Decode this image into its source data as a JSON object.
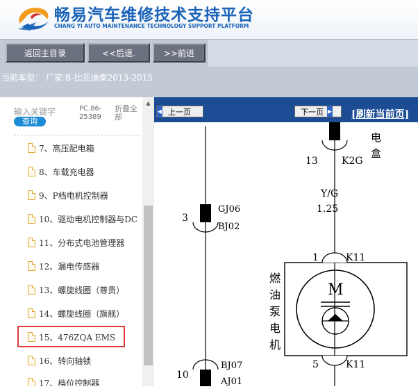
{
  "header": {
    "title": "畅易汽车维修技术支持平台",
    "subtitle": "CHANG YI AUTO MAINTENANCE TECHNOLOGY SUPPORT PLATFORM"
  },
  "toolbar": {
    "home_label": "返回主目录",
    "back_label": "<<后退.",
    "forward_label": ">>前进"
  },
  "model": {
    "label": "当前车型：",
    "value": "厂家:B-比亚迪秦2013-2015"
  },
  "sidebar": {
    "keyword_label": "输入关键字",
    "search_label": "查询",
    "pc_code": "PC.86-25389",
    "collapse_label": "折叠全部",
    "items": [
      {
        "label": "7、高压配电箱"
      },
      {
        "label": "8、车载充电器"
      },
      {
        "label": "9、P档电机控制器"
      },
      {
        "label": "10、驱动电机控制器与DC"
      },
      {
        "label": "11、分布式电池管理器"
      },
      {
        "label": "12、漏电传感器"
      },
      {
        "label": "13、螺旋线圈（尊贵）"
      },
      {
        "label": "14、螺旋线圈（旗舰）"
      },
      {
        "label": "15、476ZQA EMS"
      },
      {
        "label": "16、转向轴锁"
      },
      {
        "label": "17、档位控制器"
      }
    ],
    "selected_index": 8
  },
  "viewer": {
    "prev_label": "上一页",
    "next_label": "下一页",
    "refresh_label": "[刷新当前页]"
  },
  "diagram": {
    "left_connector_1": {
      "pin": "3",
      "top": "GJ06",
      "bottom": "BJ02"
    },
    "left_connector_2": {
      "pin": "10",
      "top": "BJ07",
      "bottom": "AJ01"
    },
    "top_box_label": "电盒",
    "top_box_char1": "电",
    "top_box_char2": "盒",
    "top_pin": "13",
    "top_conn": "K2G",
    "wire_color": "Y/G",
    "wire_size": "1.25",
    "pump_top_pin": "1",
    "pump_top_conn": "K11",
    "pump_bottom_pin": "5",
    "pump_bottom_conn": "K11",
    "pump_label": [
      "燃",
      "油",
      "泵",
      "电",
      "机"
    ],
    "motor_letter": "M"
  },
  "colors": {
    "brand_blue": "#1a63b8",
    "nav_strip": "#1b4c94",
    "toolbar_bg": "#c2cad6",
    "button_bg": "#6c7180",
    "highlight": "#e03c3c",
    "search_button": "#1d8bd6"
  },
  "icons": {
    "logo": "swirl-logo-icon",
    "tree_item": "document-icon",
    "prev": "arrow-left-icon",
    "next": "arrow-right-icon",
    "scroll_up": "triangle-up-icon"
  }
}
